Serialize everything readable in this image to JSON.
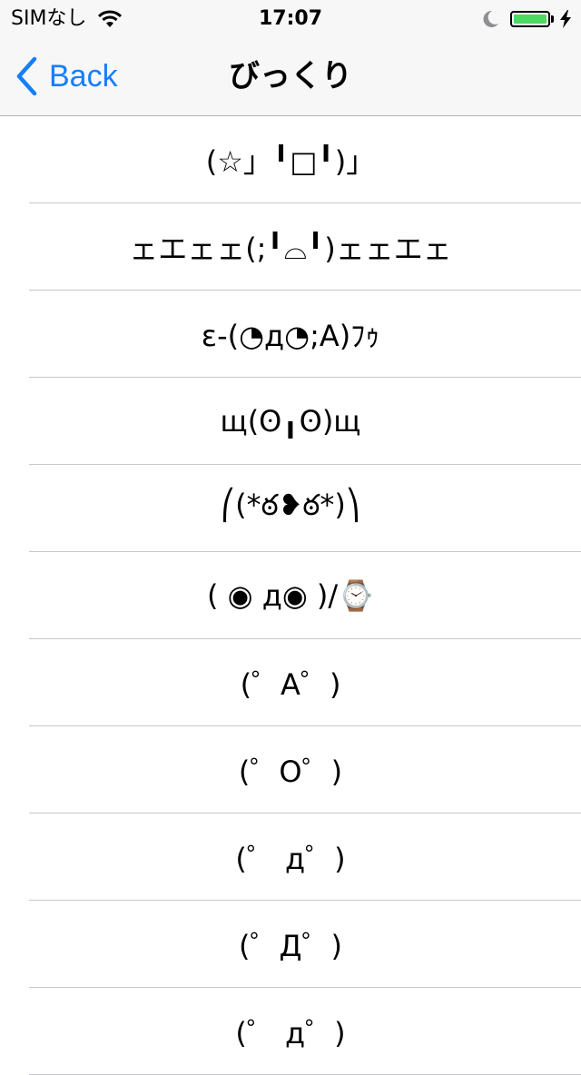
{
  "status_bar": {
    "carrier": "SIMなし",
    "time": "17:07",
    "battery_level": 1.0,
    "battery_color": "#4cd964",
    "icons": [
      "wifi-icon",
      "moon-icon",
      "battery-icon",
      "charging-bolt-icon"
    ]
  },
  "nav": {
    "back_label": "Back",
    "title": "びっくり",
    "accent": "#157efb"
  },
  "items": [
    {
      "text": "(☆」╹□╹)」"
    },
    {
      "text": "ェエェェ(;╹⌓╹)ェェエェ"
    },
    {
      "text": "ε-(◔д◔;A)ﾌｩ"
    },
    {
      "text": "щ(ʘ╻ʘ)щ"
    },
    {
      "text": "⎛(*ఠ❥ఠ*)⎞"
    },
    {
      "text": "( ◉ д◉ )/⌚"
    },
    {
      "text": "(゜A゜)"
    },
    {
      "text": "(゜O゜)"
    },
    {
      "text": "(゜ д゜)"
    },
    {
      "text": "(゜Д゜)"
    },
    {
      "text": "(゜ д゜)"
    }
  ]
}
